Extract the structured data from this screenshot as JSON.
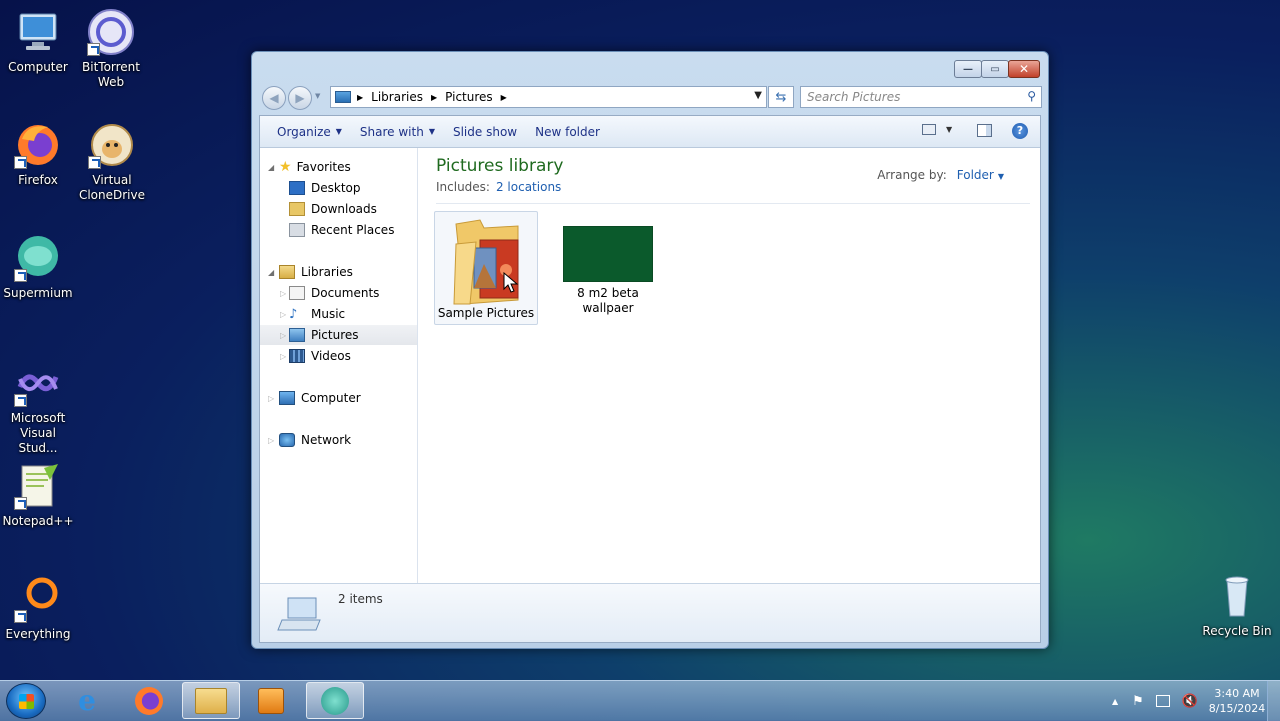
{
  "desktop": {
    "icons": [
      {
        "label": "Computer"
      },
      {
        "label": "BitTorrent Web"
      },
      {
        "label": "Firefox"
      },
      {
        "label": "Virtual CloneDrive"
      },
      {
        "label": "Supermium"
      },
      {
        "label": "Microsoft Visual Stud..."
      },
      {
        "label": "Notepad++"
      },
      {
        "label": "Everything"
      },
      {
        "label": "Recycle Bin"
      }
    ]
  },
  "window": {
    "breadcrumb": [
      "Libraries",
      "Pictures"
    ],
    "search_placeholder": "Search Pictures",
    "toolbar": {
      "organize": "Organize",
      "share_with": "Share with",
      "slide_show": "Slide show",
      "new_folder": "New folder"
    },
    "nav": {
      "favorites": "Favorites",
      "desktop": "Desktop",
      "downloads": "Downloads",
      "recent_places": "Recent Places",
      "libraries": "Libraries",
      "documents": "Documents",
      "music": "Music",
      "pictures": "Pictures",
      "videos": "Videos",
      "computer": "Computer",
      "network": "Network"
    },
    "library": {
      "title": "Pictures library",
      "includes_label": "Includes:",
      "locations_link": "2 locations",
      "arrange_label": "Arrange by:",
      "arrange_value": "Folder"
    },
    "files": [
      {
        "name": "Sample Pictures"
      },
      {
        "name": "8 m2 beta wallpaer"
      }
    ],
    "status": {
      "item_count": "2 items"
    }
  },
  "taskbar": {
    "time": "3:40 AM",
    "date": "8/15/2024"
  },
  "colors": {
    "library_title": "#1f6a1f",
    "link": "#1f5fb0",
    "wallpaper_thumb": "#0b5a2c"
  }
}
